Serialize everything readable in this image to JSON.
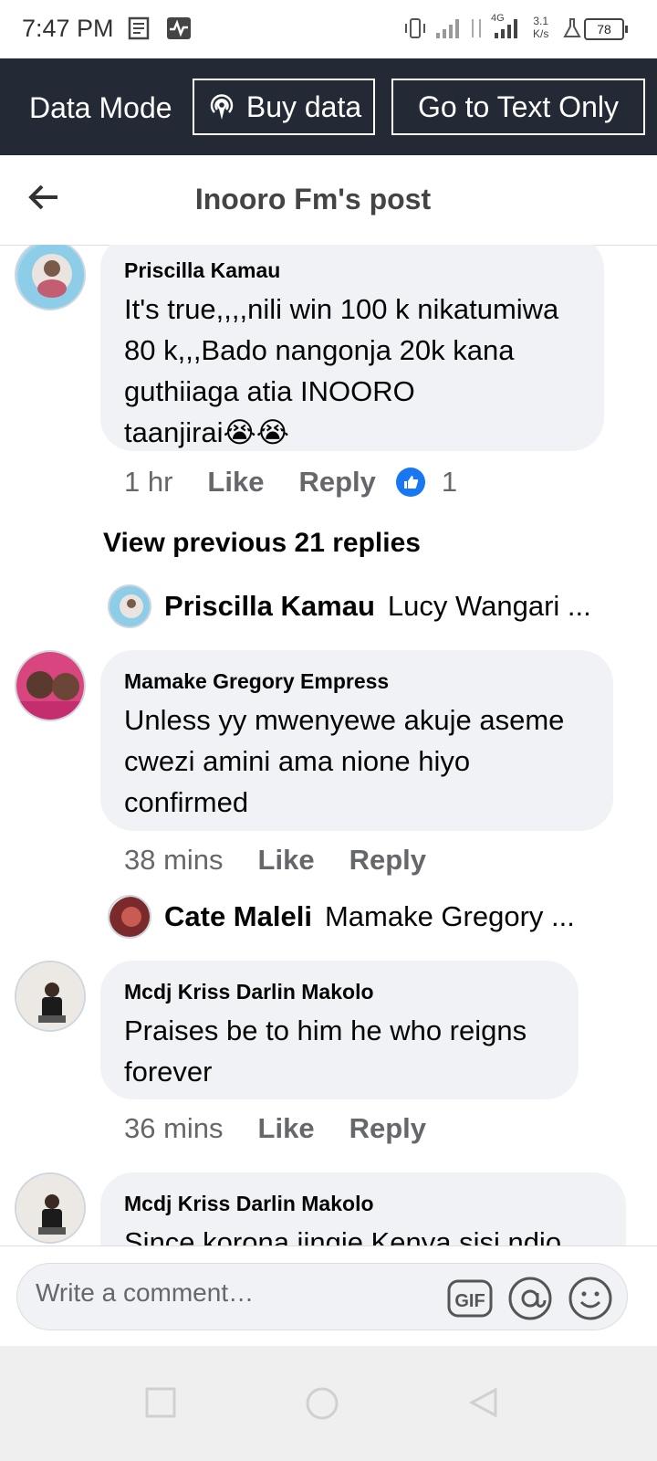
{
  "status_bar": {
    "time": "7:47 PM",
    "network_type": "4G",
    "speed_value": "3.1",
    "speed_unit": "K/s",
    "battery": "78"
  },
  "data_banner": {
    "label": "Data Mode",
    "buy_data": "Buy data",
    "text_only": "Go to Text Only"
  },
  "header": {
    "title": "Inooro Fm's post"
  },
  "comments": [
    {
      "name": "Priscilla Kamau",
      "text_lines": [
        "It's true,,,,nili win 100 k nikatumiwa",
        "80 k,,,Bado nangonja 20k kana",
        "guthiiaga atia INOORO",
        "taanjirai😭😭"
      ],
      "time": "1 hr",
      "like": "Like",
      "reply": "Reply",
      "reactions": "1"
    },
    {
      "name": "Mamake Gregory Empress",
      "text_lines": [
        "Unless yy mwenyewe akuje aseme",
        "cwezi amini ama nione hiyo",
        "confirmed"
      ],
      "time": "38 mins",
      "like": "Like",
      "reply": "Reply"
    },
    {
      "name": "Mcdj Kriss Darlin Makolo",
      "text_lines": [
        "Praises be to him he who reigns",
        "forever"
      ],
      "time": "36 mins",
      "like": "Like",
      "reply": "Reply"
    },
    {
      "name": "Mcdj Kriss Darlin Makolo",
      "text_lines": [
        "Since korona iingie Kenya sisi ndio"
      ]
    }
  ],
  "view_previous": "View previous 21 replies",
  "reply_previews": [
    {
      "name": "Priscilla Kamau",
      "text": "Lucy Wangari ..."
    },
    {
      "name": "Cate Maleli",
      "text": "Mamake Gregory ..."
    }
  ],
  "compose": {
    "placeholder": "Write a comment…"
  },
  "icons": {
    "back": "arrow-left-icon",
    "buy": "broadcast-icon",
    "gif": "gif-icon",
    "mention": "at-icon",
    "emoji": "smiley-icon",
    "like": "thumbs-up-icon"
  },
  "colors": {
    "banner_bg": "#232a35",
    "bubble_bg": "#f0f2f5",
    "like_blue": "#1877f2"
  }
}
